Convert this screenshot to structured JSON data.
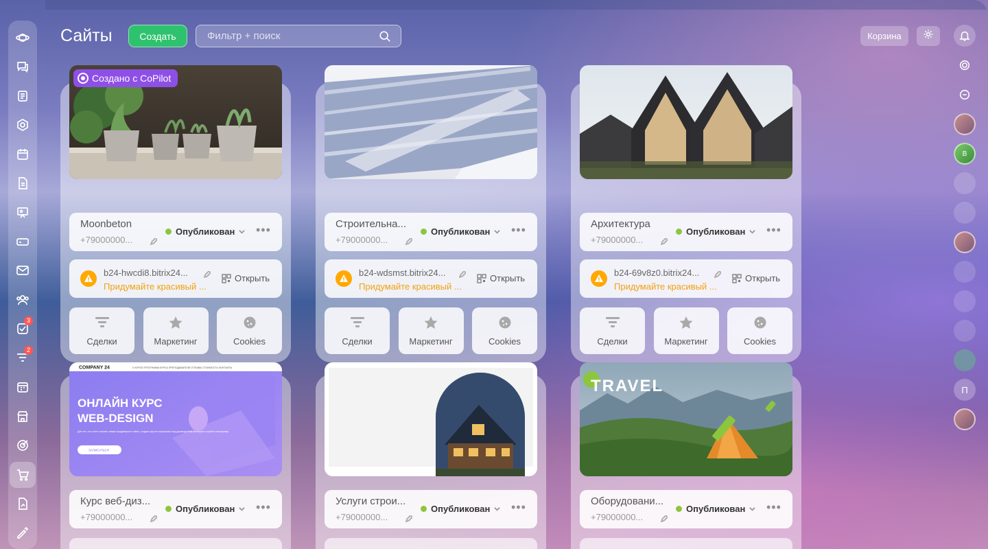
{
  "page": {
    "title": "Сайты"
  },
  "toolbar": {
    "create_label": "Создать",
    "search_placeholder": "Фильтр + поиск",
    "cart_label": "Корзина"
  },
  "sidebar": {
    "items": [
      {
        "icon": "planet-icon",
        "badge": ""
      },
      {
        "icon": "chat-icon",
        "badge": ""
      },
      {
        "icon": "feed-icon",
        "badge": ""
      },
      {
        "icon": "hexagon-icon",
        "badge": ""
      },
      {
        "icon": "calendar-icon",
        "badge": ""
      },
      {
        "icon": "document-icon",
        "badge": ""
      },
      {
        "icon": "presentation-icon",
        "badge": ""
      },
      {
        "icon": "drive-icon",
        "badge": ""
      },
      {
        "icon": "mail-icon",
        "badge": ""
      },
      {
        "icon": "contacts-icon",
        "badge": ""
      },
      {
        "icon": "tasks-icon",
        "badge": "3"
      },
      {
        "icon": "crm-filter-icon",
        "badge": "2"
      },
      {
        "icon": "schedule-icon",
        "badge": ""
      },
      {
        "icon": "store-icon",
        "badge": ""
      },
      {
        "icon": "target-icon",
        "badge": ""
      },
      {
        "icon": "cart-icon",
        "badge": ""
      },
      {
        "icon": "sign-document-icon",
        "badge": ""
      },
      {
        "icon": "signature-icon",
        "badge": ""
      }
    ]
  },
  "right_rail": {
    "items": [
      "bell-icon",
      "copilot-icon",
      "chat-bubble-icon",
      "avatar",
      "avatar-b",
      "hex-chat",
      "hex-chat",
      "avatar",
      "faint",
      "avatar",
      "video-icon",
      "video-icon",
      "letter-avatar",
      "avatar"
    ],
    "avatar_b_text": "B",
    "letter_text": "П"
  },
  "sites": [
    {
      "name": "Moonbeton",
      "phone": "+79000000...",
      "status": "Опубликован",
      "domain": "b24-hwcdi8.bitrix24...",
      "domain_hint": "Придумайте красивый ...",
      "open_label": "Открыть",
      "badge": "Создано с CoPilot",
      "actions": [
        "Сделки",
        "Маркетинг",
        "Cookies"
      ]
    },
    {
      "name": "Строительна...",
      "phone": "+79000000...",
      "status": "Опубликован",
      "domain": "b24-wdsmst.bitrix24...",
      "domain_hint": "Придумайте красивый ...",
      "open_label": "Открыть",
      "actions": [
        "Сделки",
        "Маркетинг",
        "Cookies"
      ]
    },
    {
      "name": "Архитектура",
      "phone": "+79000000...",
      "status": "Опубликован",
      "domain": "b24-69v8z0.bitrix24...",
      "domain_hint": "Придумайте красивый ...",
      "open_label": "Открыть",
      "actions": [
        "Сделки",
        "Маркетинг",
        "Cookies"
      ]
    },
    {
      "name": "Курс веб-диз...",
      "phone": "+79000000...",
      "status": "Опубликован",
      "thumb": {
        "brand": "COMPANY 24",
        "nav": "О КУРСЕ   ПРОГРАММА КУРСА   ПРЕПОДАВАТЕЛИ   ОТЗЫВЫ   СТОИМОСТЬ   КОНТАКТЫ",
        "headline_1": "ОНЛАЙН КУРС",
        "headline_2": "WEB-DESIGN",
        "body": "Для тех, кто хочет освоить самые продвинутые сайты, создать крутое портфолио под руководством менторов и пройти стажировку",
        "cta": "ЗАПИСАТЬСЯ"
      }
    },
    {
      "name": "Услуги строи...",
      "phone": "+79000000...",
      "status": "Опубликован"
    },
    {
      "name": "Оборудовани...",
      "phone": "+79000000...",
      "status": "Опубликован",
      "thumb": {
        "headline": "TRAVEL"
      }
    }
  ]
}
